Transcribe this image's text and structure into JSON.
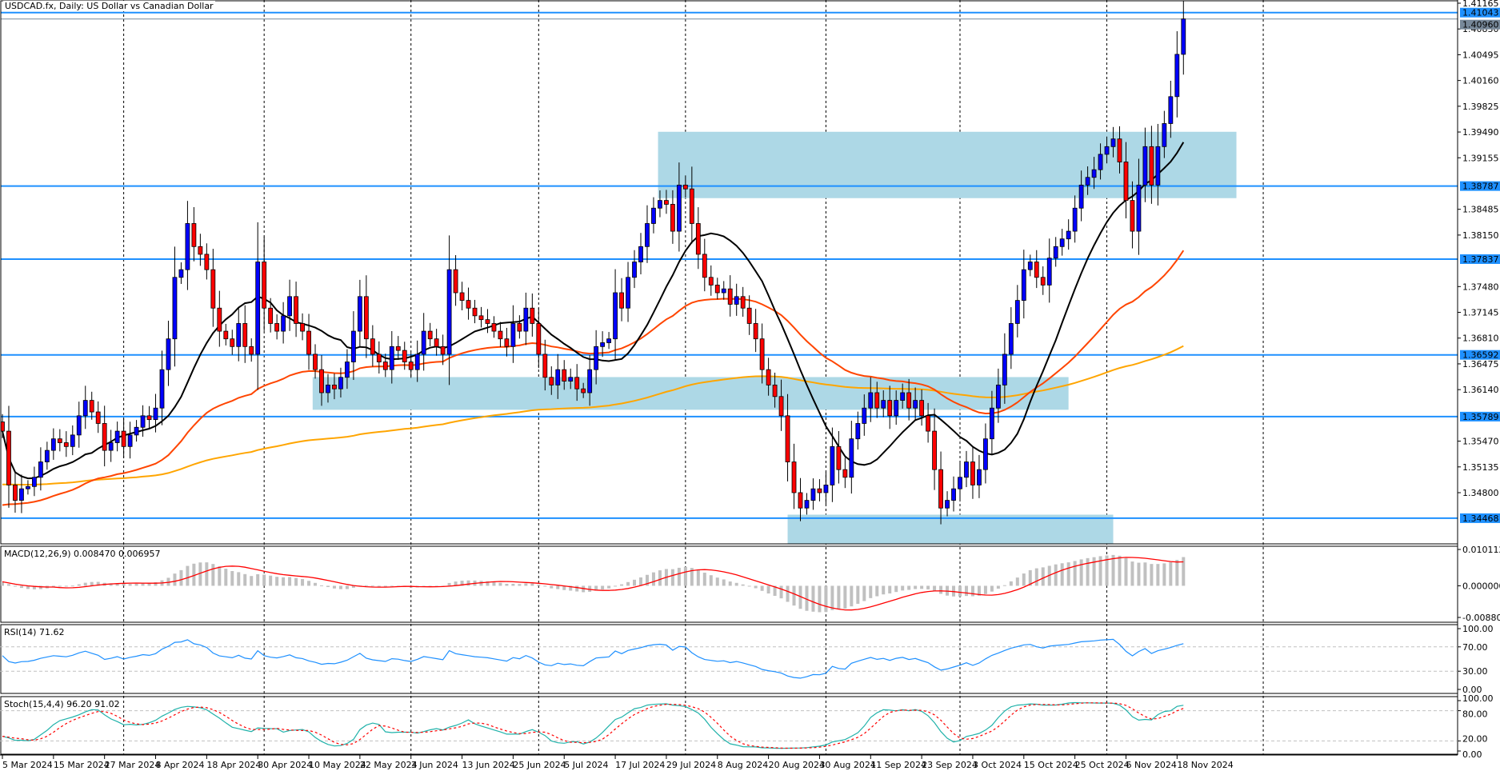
{
  "header": {
    "title": "USDCAD.fx, Daily:  US Dollar vs Canadian Dollar"
  },
  "indicators": {
    "macd": {
      "label": "MACD(12,26,9) 0.008470 0.006957",
      "axis": [
        "0.010112",
        "0.000000",
        "-0.008807"
      ],
      "range": [
        -0.008807,
        0.010112
      ]
    },
    "rsi": {
      "label": "RSI(14) 71.62",
      "axis": [
        "100.00",
        "70.00",
        "30.00",
        "0.00"
      ],
      "levels": [
        70,
        30
      ]
    },
    "stoch": {
      "label": "Stoch(15,4,4) 96.20 91.02",
      "axis": [
        "100.00",
        "80.00",
        "20.00",
        "0.00"
      ],
      "levels": [
        80,
        20
      ]
    }
  },
  "colors": {
    "bull": "#0000ff",
    "bear": "#ff0000",
    "level_line": "#1e90ff",
    "zone": "#add8e6",
    "ma_fast": "#000000",
    "ma_mid": "#ff4500",
    "ma_slow": "#ffa500",
    "macd_hist": "#c0c0c0",
    "macd_signal": "#ff0000",
    "rsi": "#1e90ff",
    "stoch_main": "#20b2aa",
    "stoch_signal": "#ff0000",
    "last_price": "#778899"
  },
  "chart_data": {
    "type": "candlestick",
    "symbol": "USDCAD.fx",
    "timeframe": "Daily",
    "ylim": [
      1.341,
      1.41165
    ],
    "price_ticks": [
      "1.41165",
      "1.40830",
      "1.40495",
      "1.40160",
      "1.39825",
      "1.39490",
      "1.39155",
      "1.38485",
      "1.38150",
      "1.37480",
      "1.37145",
      "1.36810",
      "1.36475",
      "1.36140",
      "1.35470",
      "1.35135",
      "1.34800"
    ],
    "date_ticks": [
      "5 Mar 2024",
      "15 Mar 2024",
      "27 Mar 2024",
      "8 Apr 2024",
      "18 Apr 2024",
      "30 Apr 2024",
      "10 May 2024",
      "22 May 2024",
      "3 Jun 2024",
      "13 Jun 2024",
      "25 Jun 2024",
      "5 Jul 2024",
      "17 Jul 2024",
      "29 Jul 2024",
      "8 Aug 2024",
      "20 Aug 2024",
      "30 Aug 2024",
      "11 Sep 2024",
      "23 Sep 2024",
      "3 Oct 2024",
      "15 Oct 2024",
      "25 Oct 2024",
      "6 Nov 2024",
      "18 Nov 2024"
    ],
    "date_tick_every_bars": 8,
    "closes": [
      1.356,
      1.349,
      1.347,
      1.3485,
      1.3488,
      1.35,
      1.352,
      1.3535,
      1.355,
      1.3545,
      1.354,
      1.3555,
      1.358,
      1.36,
      1.3585,
      1.357,
      1.3535,
      1.3545,
      1.356,
      1.354,
      1.3555,
      1.3565,
      1.358,
      1.3575,
      1.359,
      1.364,
      1.368,
      1.376,
      1.377,
      1.383,
      1.38,
      1.379,
      1.377,
      1.372,
      1.369,
      1.368,
      1.367,
      1.37,
      1.367,
      1.366,
      1.378,
      1.372,
      1.37,
      1.369,
      1.371,
      1.3735,
      1.37,
      1.369,
      1.366,
      1.364,
      1.361,
      1.362,
      1.3615,
      1.363,
      1.365,
      1.369,
      1.3735,
      1.368,
      1.366,
      1.365,
      1.364,
      1.367,
      1.3665,
      1.365,
      1.364,
      1.366,
      1.369,
      1.368,
      1.367,
      1.366,
      1.377,
      1.374,
      1.373,
      1.372,
      1.371,
      1.3705,
      1.37,
      1.369,
      1.368,
      1.367,
      1.37,
      1.369,
      1.372,
      1.37,
      1.366,
      1.363,
      1.362,
      1.364,
      1.3625,
      1.363,
      1.3615,
      1.361,
      1.364,
      1.367,
      1.3675,
      1.368,
      1.374,
      1.372,
      1.376,
      1.378,
      1.38,
      1.383,
      1.385,
      1.386,
      1.3855,
      1.382,
      1.388,
      1.3875,
      1.383,
      1.379,
      1.376,
      1.375,
      1.374,
      1.3745,
      1.3725,
      1.3735,
      1.372,
      1.37,
      1.368,
      1.364,
      1.362,
      1.3605,
      1.358,
      1.352,
      1.348,
      1.346,
      1.347,
      1.3485,
      1.348,
      1.349,
      1.354,
      1.351,
      1.35,
      1.355,
      1.357,
      1.359,
      1.361,
      1.359,
      1.36,
      1.358,
      1.36,
      1.361,
      1.359,
      1.36,
      1.358,
      1.356,
      1.351,
      1.346,
      1.347,
      1.3485,
      1.35,
      1.352,
      1.349,
      1.351,
      1.355,
      1.359,
      1.362,
      1.366,
      1.37,
      1.373,
      1.377,
      1.378,
      1.376,
      1.375,
      1.3785,
      1.38,
      1.381,
      1.382,
      1.385,
      1.388,
      1.389,
      1.39,
      1.392,
      1.393,
      1.394,
      1.391,
      1.386,
      1.382,
      1.388,
      1.393,
      1.388,
      1.393,
      1.396,
      1.3995,
      1.405,
      1.4096
    ],
    "horizontal_levels": [
      {
        "price": 1.41043,
        "label": "1.41043"
      },
      {
        "price": 1.38787,
        "label": "1.38787"
      },
      {
        "price": 1.37837,
        "label": "1.37837"
      },
      {
        "price": 1.36592,
        "label": "1.36592"
      },
      {
        "price": 1.35789,
        "label": "1.35789"
      },
      {
        "price": 1.34468,
        "label": "1.34468"
      }
    ],
    "last_price": {
      "price": 1.4096,
      "label": "1.40960"
    },
    "zones": [
      {
        "from_bar": 102.7,
        "to_bar": 193.3,
        "top": 1.39493,
        "bottom": 1.3863
      },
      {
        "from_bar": 48.6,
        "to_bar": 167.0,
        "top": 1.36303,
        "bottom": 1.35878
      },
      {
        "from_bar": 123.0,
        "to_bar": 174.0,
        "top": 1.34514,
        "bottom": 1.34101
      }
    ],
    "moving_averages": [
      "fast (black)",
      "mid (red)",
      "slow (orange)"
    ]
  }
}
